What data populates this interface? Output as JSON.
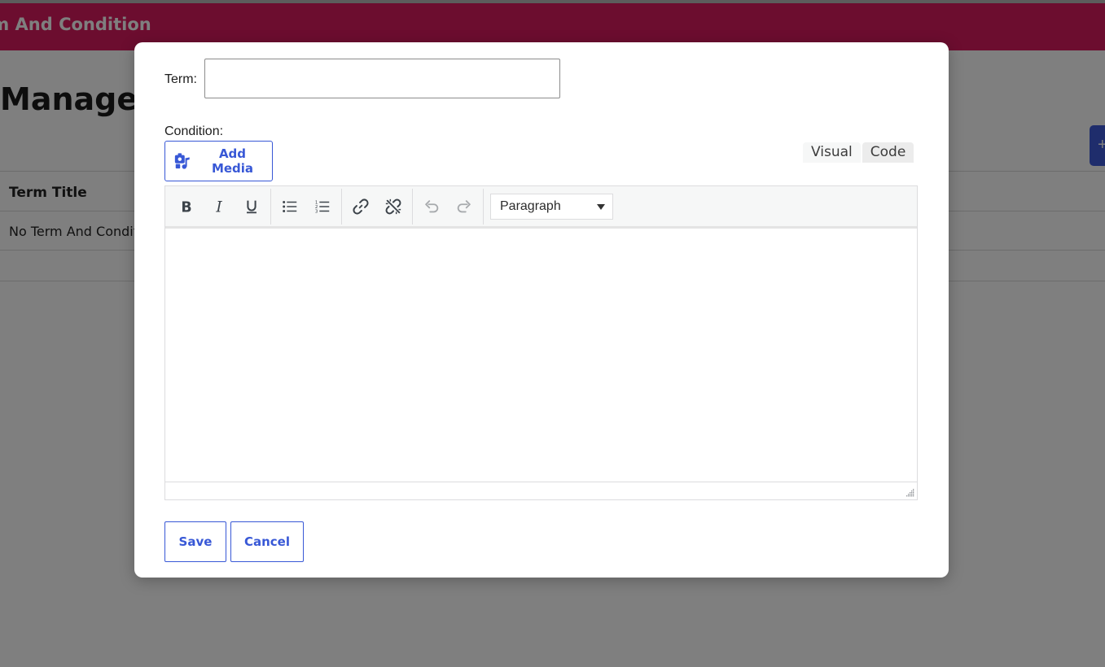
{
  "header": {
    "title": "rm And Condition",
    "color": "#d91a5e"
  },
  "page": {
    "heading": "Manage T",
    "add_button_glyph": "+"
  },
  "table": {
    "column_header": "Term Title",
    "empty_message": "No Term And Conditi"
  },
  "modal": {
    "term_label": "Term:",
    "term_value": "",
    "condition_label": "Condition:",
    "add_media_label": "Add Media",
    "tabs": [
      {
        "label": "Visual",
        "active": true
      },
      {
        "label": "Code",
        "active": false
      }
    ],
    "toolbar": {
      "items": [
        "bold-icon",
        "italic-icon",
        "underline-icon",
        "bullet-list-icon",
        "numbered-list-icon",
        "link-icon",
        "unlink-icon",
        "undo-icon",
        "redo-icon"
      ],
      "format_select": "Paragraph"
    },
    "save_label": "Save",
    "cancel_label": "Cancel",
    "accent_color": "#3858d6"
  }
}
